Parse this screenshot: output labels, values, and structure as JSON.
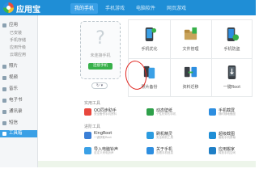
{
  "app": {
    "title": "应用宝"
  },
  "tabs": [
    {
      "label": "我的手机",
      "active": true
    },
    {
      "label": "手机游戏",
      "active": false
    },
    {
      "label": "电脑软件",
      "active": false
    },
    {
      "label": "网页游戏",
      "active": false
    }
  ],
  "sidebar": {
    "items": [
      {
        "label": "应用",
        "sub": false,
        "active": false
      },
      {
        "label": "已安装",
        "sub": true,
        "active": false
      },
      {
        "label": "手机存储",
        "sub": true,
        "active": false
      },
      {
        "label": "应用升级",
        "sub": true,
        "active": false
      },
      {
        "label": "云端应用",
        "sub": true,
        "active": false
      },
      {
        "label": "照片",
        "sub": false,
        "active": false
      },
      {
        "label": "视频",
        "sub": false,
        "active": false
      },
      {
        "label": "音乐",
        "sub": false,
        "active": false
      },
      {
        "label": "电子书",
        "sub": false,
        "active": false
      },
      {
        "label": "通讯录",
        "sub": false,
        "active": false
      },
      {
        "label": "短信",
        "sub": false,
        "active": false
      },
      {
        "label": "工具箱",
        "sub": false,
        "active": true
      }
    ]
  },
  "phone": {
    "status_text": "未连接手机",
    "connect_label": "连接手机",
    "refresh_label": "↻ ▾"
  },
  "grid": {
    "cells": [
      {
        "label": "手机优化",
        "icon": "phone-optimize-icon"
      },
      {
        "label": "文件管理",
        "icon": "file-manager-icon"
      },
      {
        "label": "手机防盗",
        "icon": "anti-theft-icon"
      },
      {
        "label": "照片备份",
        "icon": "photo-backup-icon"
      },
      {
        "label": "资料迁移",
        "icon": "data-migration-icon"
      },
      {
        "label": "一键Root",
        "icon": "root-icon"
      }
    ]
  },
  "sections": {
    "common": "实用工具",
    "advanced": "进阶工具"
  },
  "tools": [
    {
      "label": "QQ同步助手",
      "desc": "安全备份手机资料",
      "color": "#e8473d"
    },
    {
      "label": "动态壁纸",
      "desc": "个性化你的手机",
      "color": "#2ea04a"
    },
    {
      "label": "手机截屏",
      "desc": "随时随地截图",
      "color": "#2d8ee0"
    },
    {
      "label": "KingRoot",
      "desc": "一键获取Root",
      "color": "#3a7fd6"
    },
    {
      "label": "刷机精灵",
      "desc": "安全刷机工具",
      "color": "#2b9be0"
    },
    {
      "label": "超级截图",
      "desc": "截取手机屏幕",
      "color": "#1f8ed6"
    },
    {
      "label": "导入电脑铃声",
      "desc": "自定义来电铃声",
      "color": "#3aa0e6"
    },
    {
      "label": "关于手机",
      "desc": "查看手机信息",
      "color": "#2d8ee0"
    },
    {
      "label": "应用搬家",
      "desc": "释放手机空间",
      "color": "#1f7fc6"
    }
  ]
}
